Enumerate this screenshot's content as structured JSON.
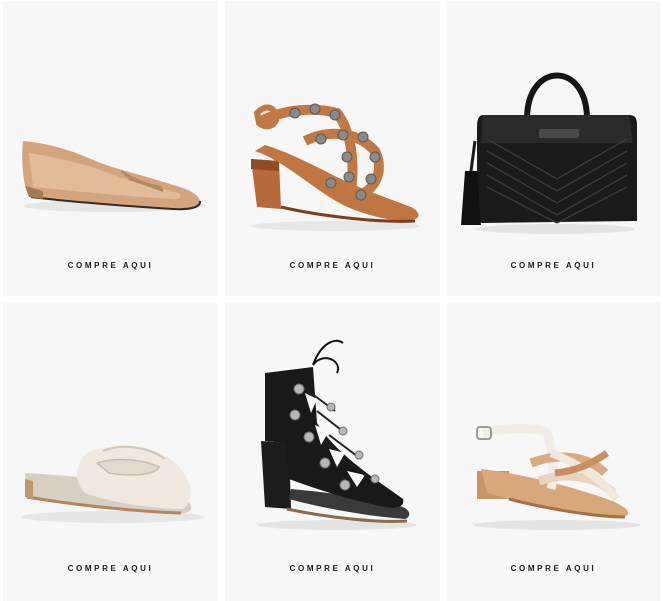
{
  "products": [
    {
      "id": "flat",
      "cta": "COMPRE AQUI",
      "icon": "nude-pointed-flat-shoe"
    },
    {
      "id": "stud-sandal",
      "cta": "COMPRE AQUI",
      "icon": "studded-tan-sandal"
    },
    {
      "id": "handbag",
      "cta": "COMPRE AQUI",
      "icon": "black-quilted-handbag"
    },
    {
      "id": "mule",
      "cta": "COMPRE AQUI",
      "icon": "cream-loafer-mule"
    },
    {
      "id": "lace-bootie",
      "cta": "COMPRE AQUI",
      "icon": "black-lace-up-bootie"
    },
    {
      "id": "strap-sandal",
      "cta": "COMPRE AQUI",
      "icon": "strappy-two-tone-sandal"
    }
  ],
  "colors": {
    "card_bg": "#f7f7f8",
    "text": "#1b1b1b"
  }
}
